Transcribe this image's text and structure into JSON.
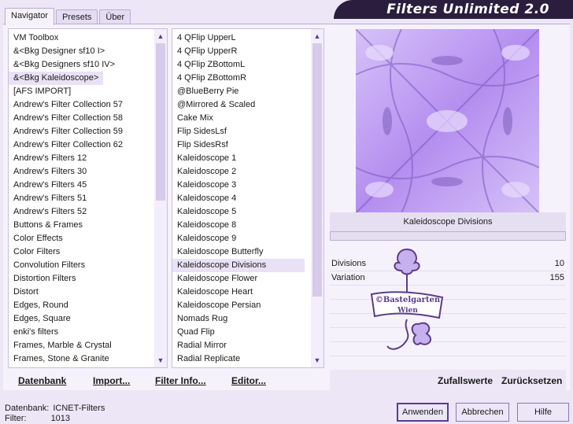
{
  "title": "Filters Unlimited 2.0",
  "tabs": [
    "Navigator",
    "Presets",
    "Über"
  ],
  "categories": [
    "VM Toolbox",
    "&<Bkg Designer sf10 I>",
    "&<Bkg Designers sf10 IV>",
    "&<Bkg Kaleidoscope>",
    "[AFS IMPORT]",
    "Andrew's Filter Collection 57",
    "Andrew's Filter Collection 58",
    "Andrew's Filter Collection 59",
    "Andrew's Filter Collection 62",
    "Andrew's Filters 12",
    "Andrew's Filters 30",
    "Andrew's Filters 45",
    "Andrew's Filters 51",
    "Andrew's Filters 52",
    "Buttons & Frames",
    "Color Effects",
    "Color Filters",
    "Convolution Filters",
    "Distortion Filters",
    "Distort",
    "Edges, Round",
    "Edges, Square",
    "enki's filters",
    "Frames, Marble & Crystal",
    "Frames, Stone & Granite"
  ],
  "selected_category_index": 3,
  "filters": [
    "4 QFlip UpperL",
    "4 QFlip UpperR",
    "4 QFlip ZBottomL",
    "4 QFlip ZBottomR",
    "@BlueBerry Pie",
    "@Mirrored & Scaled",
    "Cake Mix",
    "Flip SidesLsf",
    "Flip SidesRsf",
    "Kaleidoscope 1",
    "Kaleidoscope 2",
    "Kaleidoscope 3",
    "Kaleidoscope 4",
    "Kaleidoscope 5",
    "Kaleidoscope 8",
    "Kaleidoscope 9",
    "Kaleidoscope Butterfly",
    "Kaleidoscope Divisions",
    "Kaleidoscope Flower",
    "Kaleidoscope Heart",
    "Kaleidoscope Persian",
    "Nomads Rug",
    "Quad Flip",
    "Radial Mirror",
    "Radial Replicate"
  ],
  "selected_filter_index": 17,
  "toolbar": {
    "datenbank": "Datenbank",
    "import": "Import...",
    "filter_info": "Filter Info...",
    "editor": "Editor..."
  },
  "current_filter_name": "Kaleidoscope Divisions",
  "params": [
    {
      "label": "Divisions",
      "value": "10"
    },
    {
      "label": "Variation",
      "value": "155"
    }
  ],
  "random_label": "Zufallswerte",
  "reset_label": "Zurücksetzen",
  "status": {
    "db_label": "Datenbank:",
    "db_value": "ICNET-Filters",
    "filter_label": "Filter:",
    "filter_value": "1013"
  },
  "buttons": {
    "apply": "Anwenden",
    "cancel": "Abbrechen",
    "help": "Hilfe"
  },
  "watermark_text": [
    "©Bastelgarten",
    "Wien"
  ],
  "colors": {
    "title_bg": "#2a1d3d",
    "accent": "#5a3d8a",
    "preview_light": "#cdb4f5",
    "preview_dark": "#6f4fb0"
  }
}
